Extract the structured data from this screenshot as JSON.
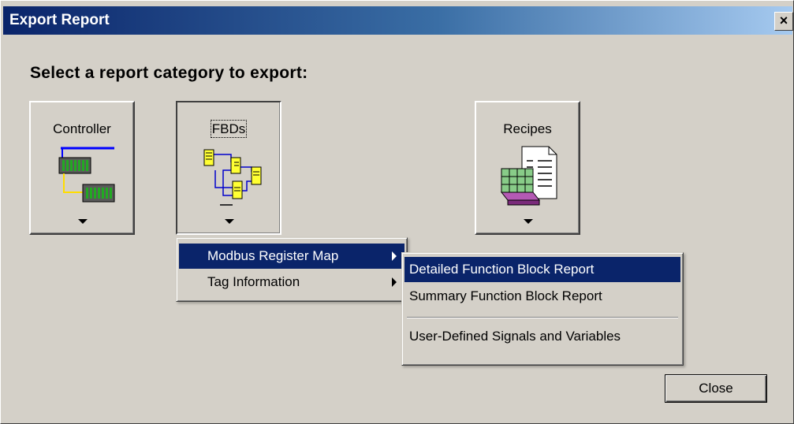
{
  "window": {
    "title": "Export Report",
    "close_glyph": "×"
  },
  "heading": "Select a report category to export:",
  "categories": [
    {
      "label": "Controller",
      "icon": "controller-icon"
    },
    {
      "label": "FBDs",
      "icon": "fbd-icon"
    },
    {
      "label": "Recipes",
      "icon": "recipes-icon"
    }
  ],
  "menu": {
    "items": [
      {
        "label": "Modbus Register Map",
        "highlighted": true
      },
      {
        "label": "Tag Information",
        "highlighted": false
      }
    ],
    "submenu": [
      {
        "label": "Detailed Function Block Report",
        "highlighted": true
      },
      {
        "label": "Summary Function Block Report",
        "highlighted": false
      },
      {
        "label": "User-Defined Signals and Variables",
        "highlighted": false
      }
    ]
  },
  "buttons": {
    "close": "Close"
  },
  "colors": {
    "title_start": "#0a246a",
    "title_end": "#a6caf0",
    "face": "#d4d0c8",
    "highlight": "#0a246a"
  }
}
